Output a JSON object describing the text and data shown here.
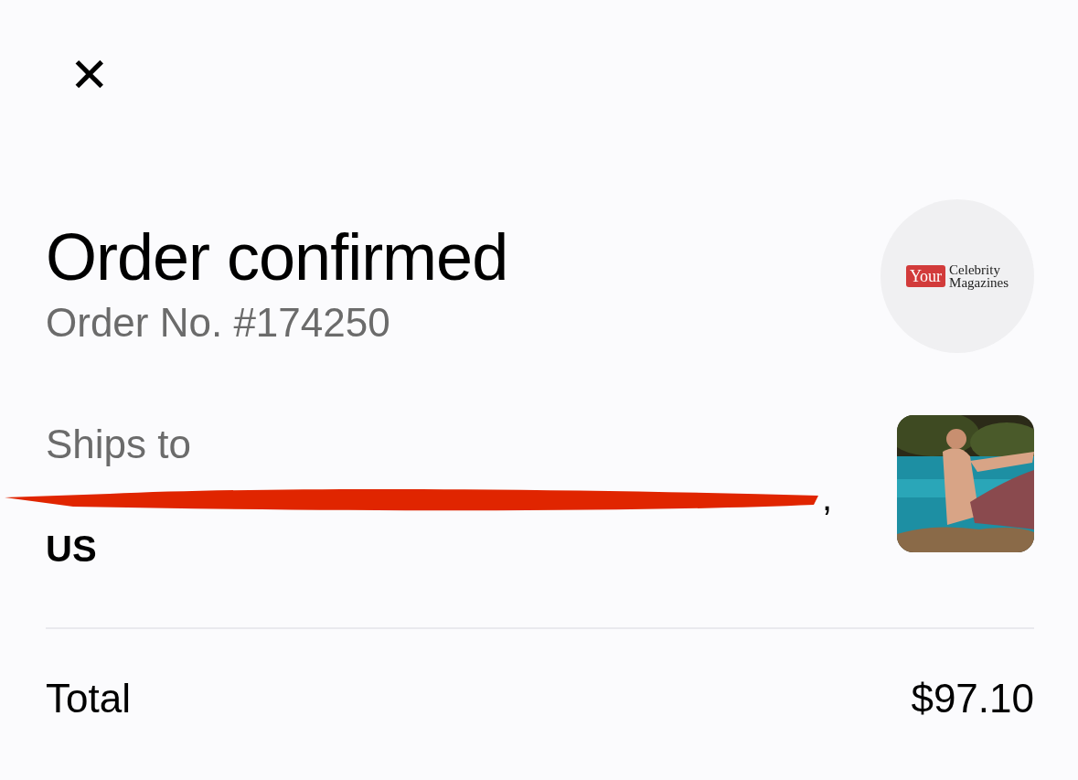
{
  "close_button": {
    "label": "✕"
  },
  "header": {
    "title": "Order confirmed",
    "order_number": "Order No. #174250"
  },
  "store_logo": {
    "badge": "Your",
    "name_line_1": "Celebrity",
    "name_line_2": "Magazines"
  },
  "shipping": {
    "label": "Ships to",
    "address_redacted": true,
    "address_line_end": ",",
    "country": "US"
  },
  "summary": {
    "label": "Total",
    "amount": "$97.10"
  }
}
